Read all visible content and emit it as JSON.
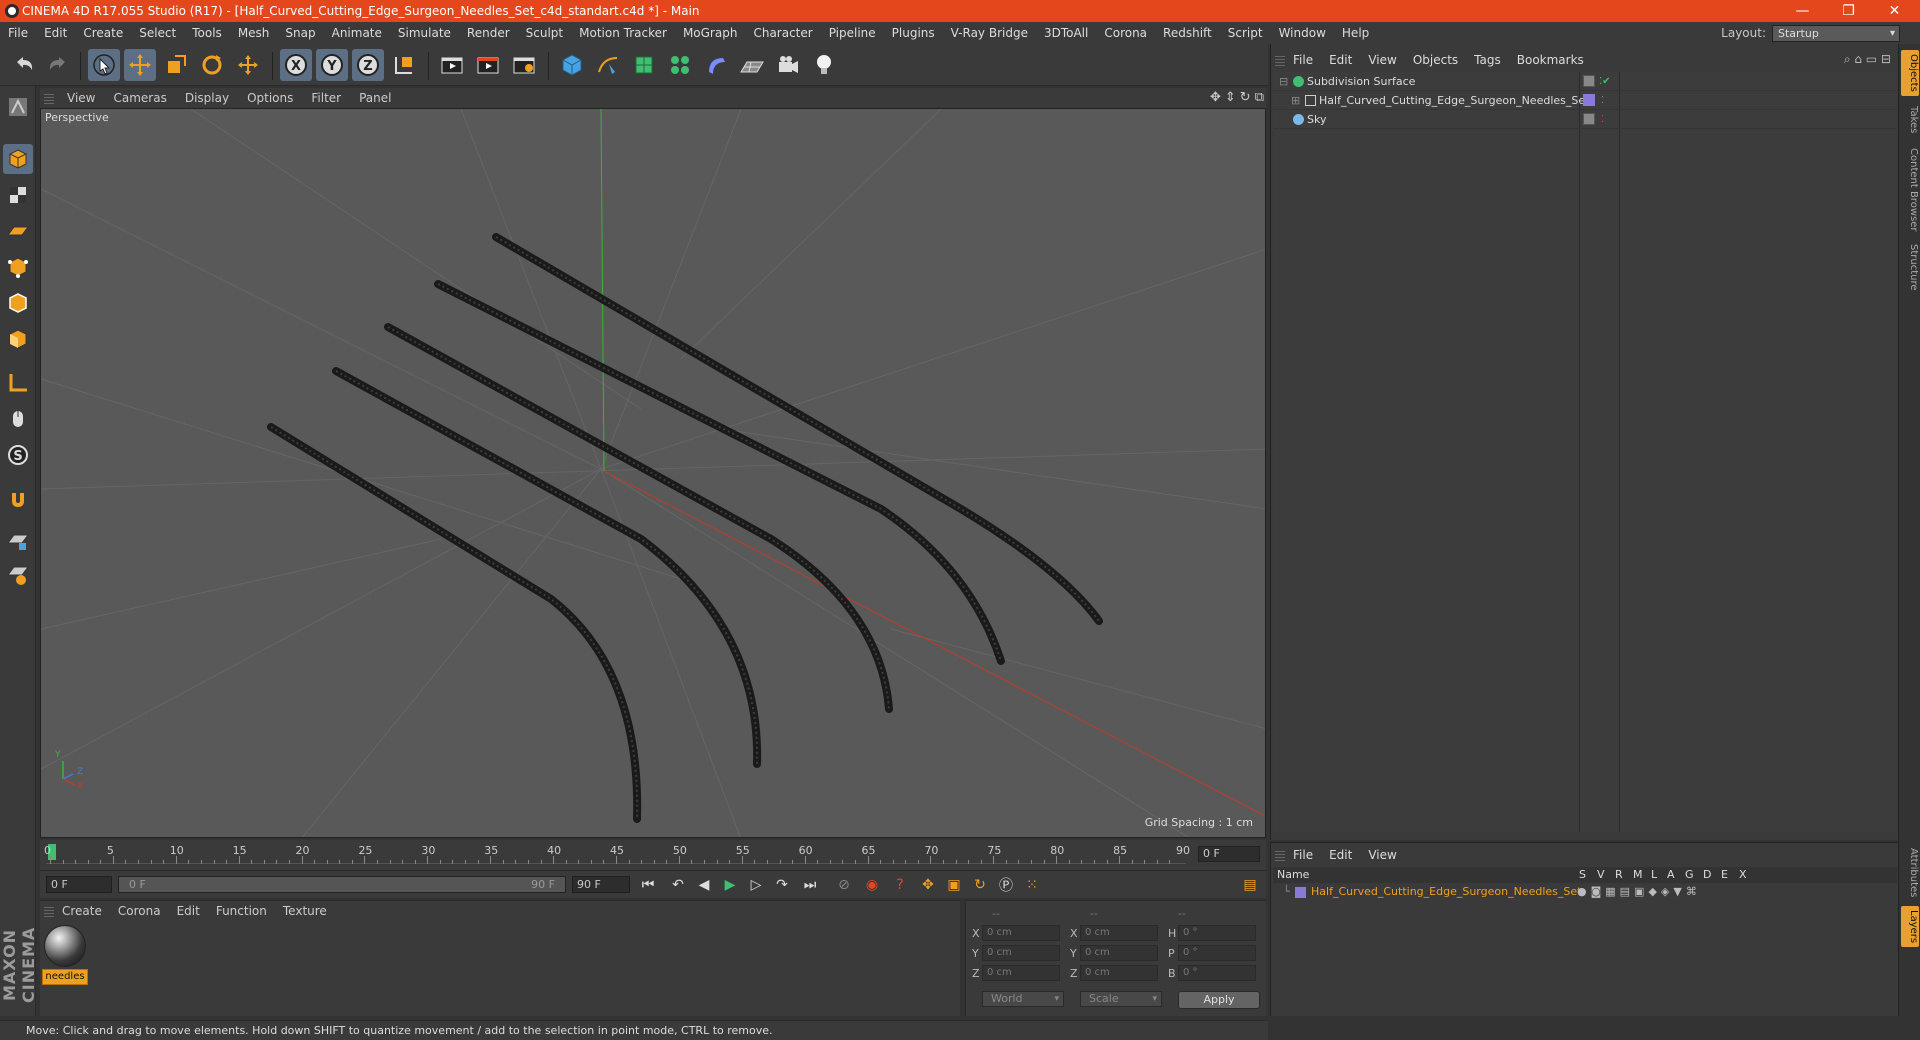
{
  "window": {
    "title": "CINEMA 4D R17.055 Studio (R17) - [Half_Curved_Cutting_Edge_Surgeon_Needles_Set_c4d_standart.c4d *] - Main",
    "minimize": "—",
    "maximize": "❐",
    "close": "✕"
  },
  "menu": [
    "File",
    "Edit",
    "Create",
    "Select",
    "Tools",
    "Mesh",
    "Snap",
    "Animate",
    "Simulate",
    "Render",
    "Sculpt",
    "Motion Tracker",
    "MoGraph",
    "Character",
    "Pipeline",
    "Plugins",
    "V-Ray Bridge",
    "3DToAll",
    "Corona",
    "Redshift",
    "Script",
    "Window",
    "Help"
  ],
  "layout": {
    "label": "Layout:",
    "value": "Startup"
  },
  "viewport": {
    "menu": [
      "View",
      "Cameras",
      "Display",
      "Options",
      "Filter",
      "Panel"
    ],
    "name": "Perspective",
    "grid_spacing": "Grid Spacing : 1 cm",
    "axis_labels": [
      "Y",
      "Z",
      "X"
    ]
  },
  "timeline": {
    "ticks": [
      "0",
      "5",
      "10",
      "15",
      "20",
      "25",
      "30",
      "35",
      "40",
      "45",
      "50",
      "55",
      "60",
      "65",
      "70",
      "75",
      "80",
      "85",
      "90"
    ],
    "current_frame": "0 F"
  },
  "playback": {
    "start": "0 F",
    "range_start": "0 F",
    "range_end": "90 F",
    "end": "90 F"
  },
  "material_manager": {
    "menu": [
      "Create",
      "Corona",
      "Edit",
      "Function",
      "Texture"
    ],
    "materials": [
      {
        "name": "needles"
      }
    ]
  },
  "coordinates": {
    "headers": [
      "--",
      "--",
      "--"
    ],
    "rows": [
      {
        "a": "X",
        "av": "0 cm",
        "b": "X",
        "bv": "0 cm",
        "c": "H",
        "cv": "0 °"
      },
      {
        "a": "Y",
        "av": "0 cm",
        "b": "Y",
        "bv": "0 cm",
        "c": "P",
        "cv": "0 °"
      },
      {
        "a": "Z",
        "av": "0 cm",
        "b": "Z",
        "bv": "0 cm",
        "c": "B",
        "cv": "0 °"
      }
    ],
    "mode1": "World",
    "mode2": "Scale",
    "apply": "Apply"
  },
  "object_manager": {
    "menu": [
      "File",
      "Edit",
      "View",
      "Objects",
      "Tags",
      "Bookmarks"
    ],
    "objects": [
      {
        "name": "Subdivision Surface"
      },
      {
        "name": "Half_Curved_Cutting_Edge_Surgeon_Needles_Set"
      },
      {
        "name": "Sky"
      }
    ]
  },
  "side_tabs": [
    "Objects",
    "Takes",
    "Content Browser",
    "Structure",
    "Attributes",
    "Layers"
  ],
  "layer_manager": {
    "menu": [
      "File",
      "Edit",
      "View"
    ],
    "columns": [
      "Name",
      "S",
      "V",
      "R",
      "M",
      "L",
      "A",
      "G",
      "D",
      "E",
      "X"
    ],
    "layers": [
      {
        "name": "Half_Curved_Cutting_Edge_Surgeon_Needles_Set",
        "color": "#8a7ad8"
      }
    ]
  },
  "status": "Move: Click and drag to move elements. Hold down SHIFT to quantize movement / add to the selection in point mode, CTRL to remove.",
  "logo": "MAXON CINEMA 4D",
  "colors": {
    "accent": "#e4471c",
    "selected_tool": "#5c6f85",
    "highlight_text": "#f0a020"
  }
}
